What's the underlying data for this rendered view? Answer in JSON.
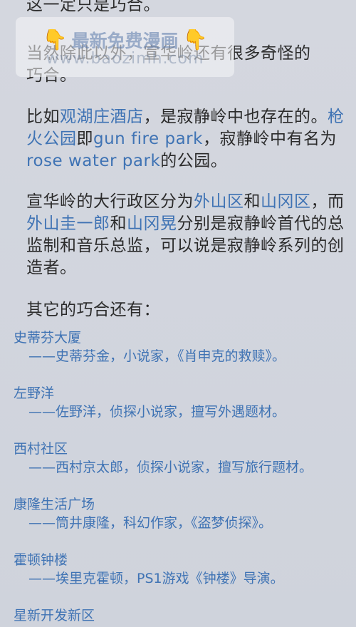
{
  "top_line": "这一定只是巧合。",
  "para1": {
    "text": "当然除此以外，宣华岭还有很多奇怪的巧合。"
  },
  "watermark": {
    "hand_left": "👇",
    "title": "最新免费漫画",
    "hand_right": "👇",
    "url": "www.baozimh.com"
  },
  "para2": {
    "p1": "比如",
    "l1": "观湖庄酒店",
    "p2": "，是寂静岭中也存在的。",
    "l2": "枪火公园",
    "p3": "即",
    "l3": "gun fire park",
    "p4": "，寂静岭中有名为",
    "l4": "rose water park",
    "p5": "的公园。"
  },
  "para3": {
    "p1": "宣华岭的大行政区分为",
    "l1": "外山区",
    "p2": "和",
    "l2": "山冈区",
    "p3": "，而",
    "l3": "外山圭一郎",
    "p4": "和",
    "l4": "山冈晃",
    "p5": "分别是寂静岭首代的总监制和音乐总监，可以说是寂静岭系列的创造者。"
  },
  "para4": "其它的巧合还有：",
  "items": [
    {
      "title": "史蒂芬大厦",
      "desc": "——史蒂芬金，小说家，《肖申克的救赎》。"
    },
    {
      "title": "左野洋",
      "desc": "——佐野洋，侦探小说家，擅写外遇题材。"
    },
    {
      "title": "西村社区",
      "desc": "——西村京太郎，侦探小说家，擅写旅行题材。"
    },
    {
      "title": "康隆生活广场",
      "desc": "——筒井康隆，科幻作家，《盗梦侦探》。"
    },
    {
      "title": "霍顿钟楼",
      "desc": "——埃里克霍顿，PS1游戏《钟楼》导演。"
    },
    {
      "title": "星新开发新区",
      "desc": ""
    }
  ]
}
